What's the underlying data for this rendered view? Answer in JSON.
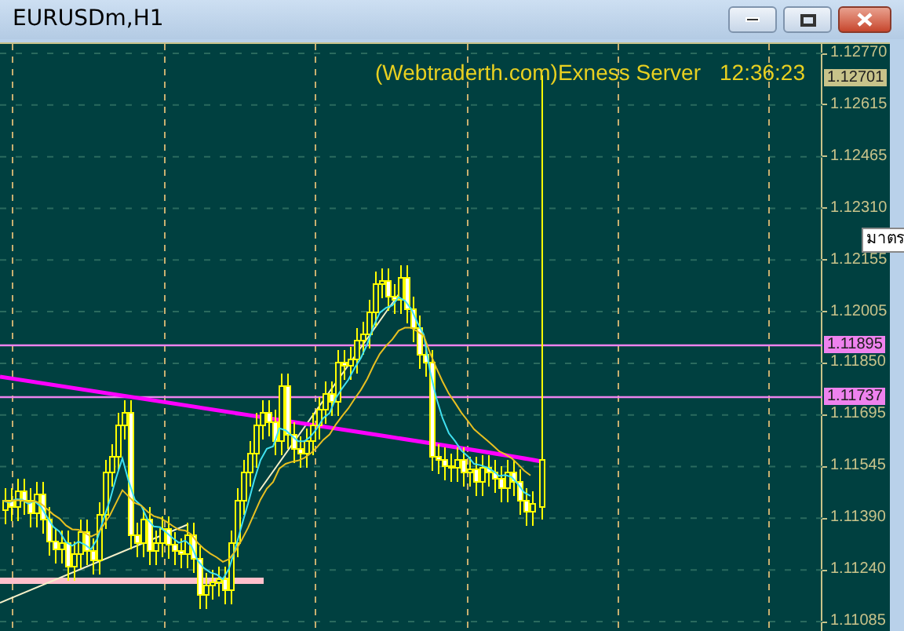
{
  "window": {
    "title": "EURUSDm,H1"
  },
  "chart": {
    "header": {
      "server": "(Webtraderth.com)Exness Server",
      "time": "12:36:23"
    },
    "price_axis": {
      "ticks": [
        "1.12770",
        "1.12615",
        "1.12465",
        "1.12310",
        "1.12155",
        "1.12005",
        "1.11850",
        "1.11695",
        "1.11545",
        "1.11390",
        "1.11240",
        "1.11085"
      ],
      "markers": [
        {
          "label": "1.12701",
          "color": "#c8c38a"
        },
        {
          "label": "1.11895",
          "color": "#ee82ee"
        },
        {
          "label": "1.11737",
          "color": "#ee82ee"
        }
      ]
    },
    "tooltip": {
      "text": "มาตร"
    }
  }
}
